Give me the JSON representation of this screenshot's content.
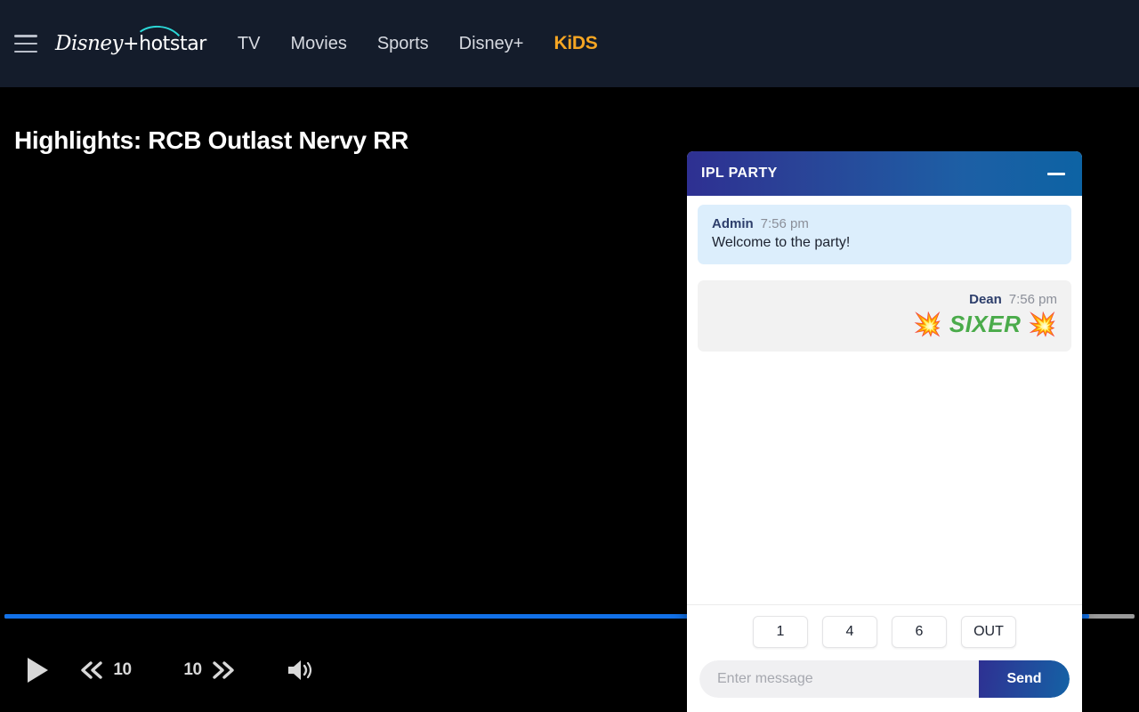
{
  "nav": {
    "menu_icon": "hamburger-icon",
    "brand": {
      "disney": "Disney",
      "plus": "+",
      "hotstar": "hotstar"
    },
    "links": [
      {
        "label": "TV",
        "kids": false
      },
      {
        "label": "Movies",
        "kids": false
      },
      {
        "label": "Sports",
        "kids": false
      },
      {
        "label": "Disney+",
        "kids": false
      },
      {
        "label": "KiDS",
        "kids": true
      }
    ]
  },
  "player": {
    "title": "Highlights: RCB Outlast Nervy RR",
    "progress_percent": 96,
    "progress_fill_color": "#1271e8",
    "progress_track_color": "#9a9a9a",
    "controls": {
      "play_icon": "play-icon",
      "rewind_label": "10",
      "forward_label": "10",
      "volume_icon": "volume-icon"
    }
  },
  "chat": {
    "title": "IPL PARTY",
    "minimize_icon": "minimize-icon",
    "header_gradient_from": "#2e3092",
    "header_gradient_to": "#0d63a4",
    "messages": [
      {
        "author": "Admin",
        "time": "7:56 pm",
        "text": "Welcome to the party!",
        "direction": "incoming",
        "emphasis": false
      },
      {
        "author": "Dean",
        "time": "7:56 pm",
        "emoji_left": "💥",
        "text": "SIXER",
        "emoji_right": "💥",
        "direction": "outgoing",
        "emphasis": true,
        "emphasis_color": "#4aab4a"
      }
    ],
    "quick_actions": [
      {
        "label": "1"
      },
      {
        "label": "4"
      },
      {
        "label": "6"
      },
      {
        "label": "OUT"
      }
    ],
    "composer": {
      "value": "",
      "placeholder": "Enter message",
      "send_label": "Send"
    }
  }
}
